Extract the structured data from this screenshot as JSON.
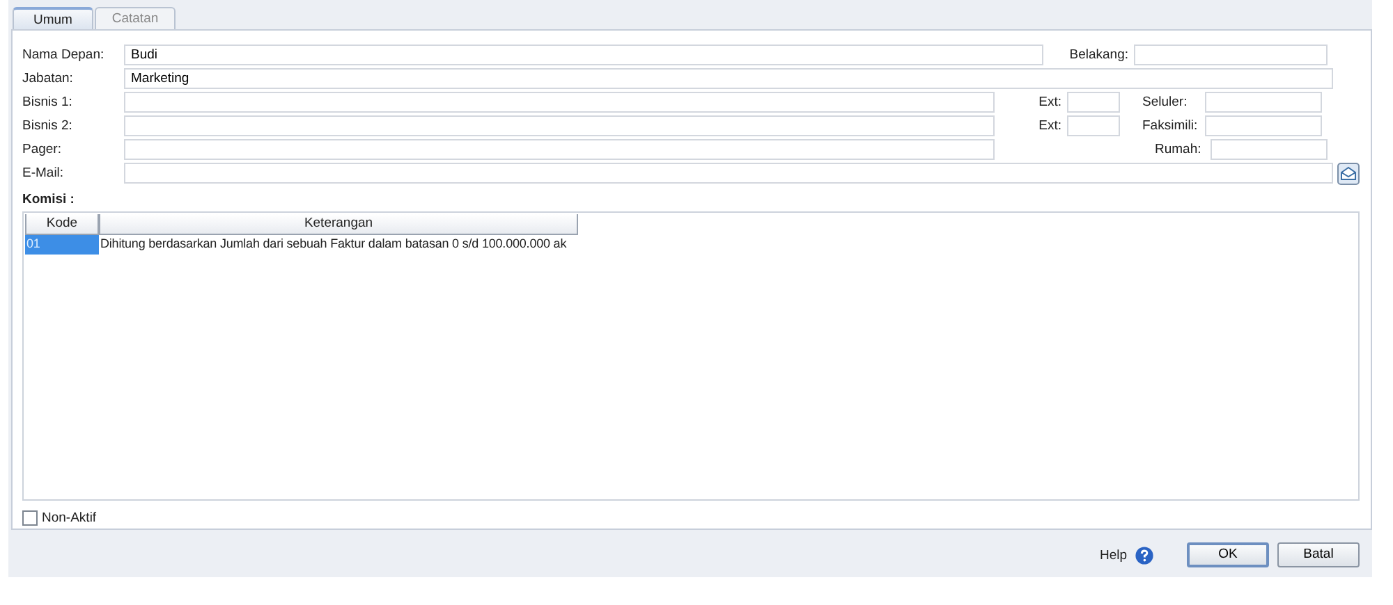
{
  "tabs": [
    {
      "label": "Umum",
      "selected": true
    },
    {
      "label": "Catatan",
      "selected": false
    }
  ],
  "form_rows": [
    [
      {
        "label": "Nama Depan:",
        "value": "Budi"
      },
      {
        "label": "Belakang:"
      }
    ],
    [
      {
        "label": "Jabatan:",
        "value": "Marketing"
      }
    ],
    [
      {
        "label": "Bisnis 1:"
      },
      {
        "label": "Ext:"
      },
      {
        "label": "Seluler:"
      }
    ],
    [
      {
        "label": "Bisnis 2:"
      },
      {
        "label": "Ext:"
      },
      {
        "label": "Faksimili:"
      }
    ],
    [
      {
        "label": "Pager:"
      },
      {
        "label": "Rumah:"
      }
    ],
    [
      {
        "label": "E-Mail:"
      }
    ]
  ],
  "commission": {
    "title": "Komisi :",
    "columns": [
      "Kode",
      "Keterangan"
    ],
    "rows": [
      {
        "cells": [
          "01",
          "Dihitung berdasarkan Jumlah dari sebuah Faktur dalam batasan 0 s/d 100.000.000 ak"
        ],
        "selected": true
      }
    ]
  },
  "inactive": {
    "label": "Non-Aktif",
    "checked": false
  },
  "help": "Help",
  "buttons": [
    {
      "label": "OK",
      "default": true
    },
    {
      "label": "Batal",
      "default": false
    }
  ]
}
